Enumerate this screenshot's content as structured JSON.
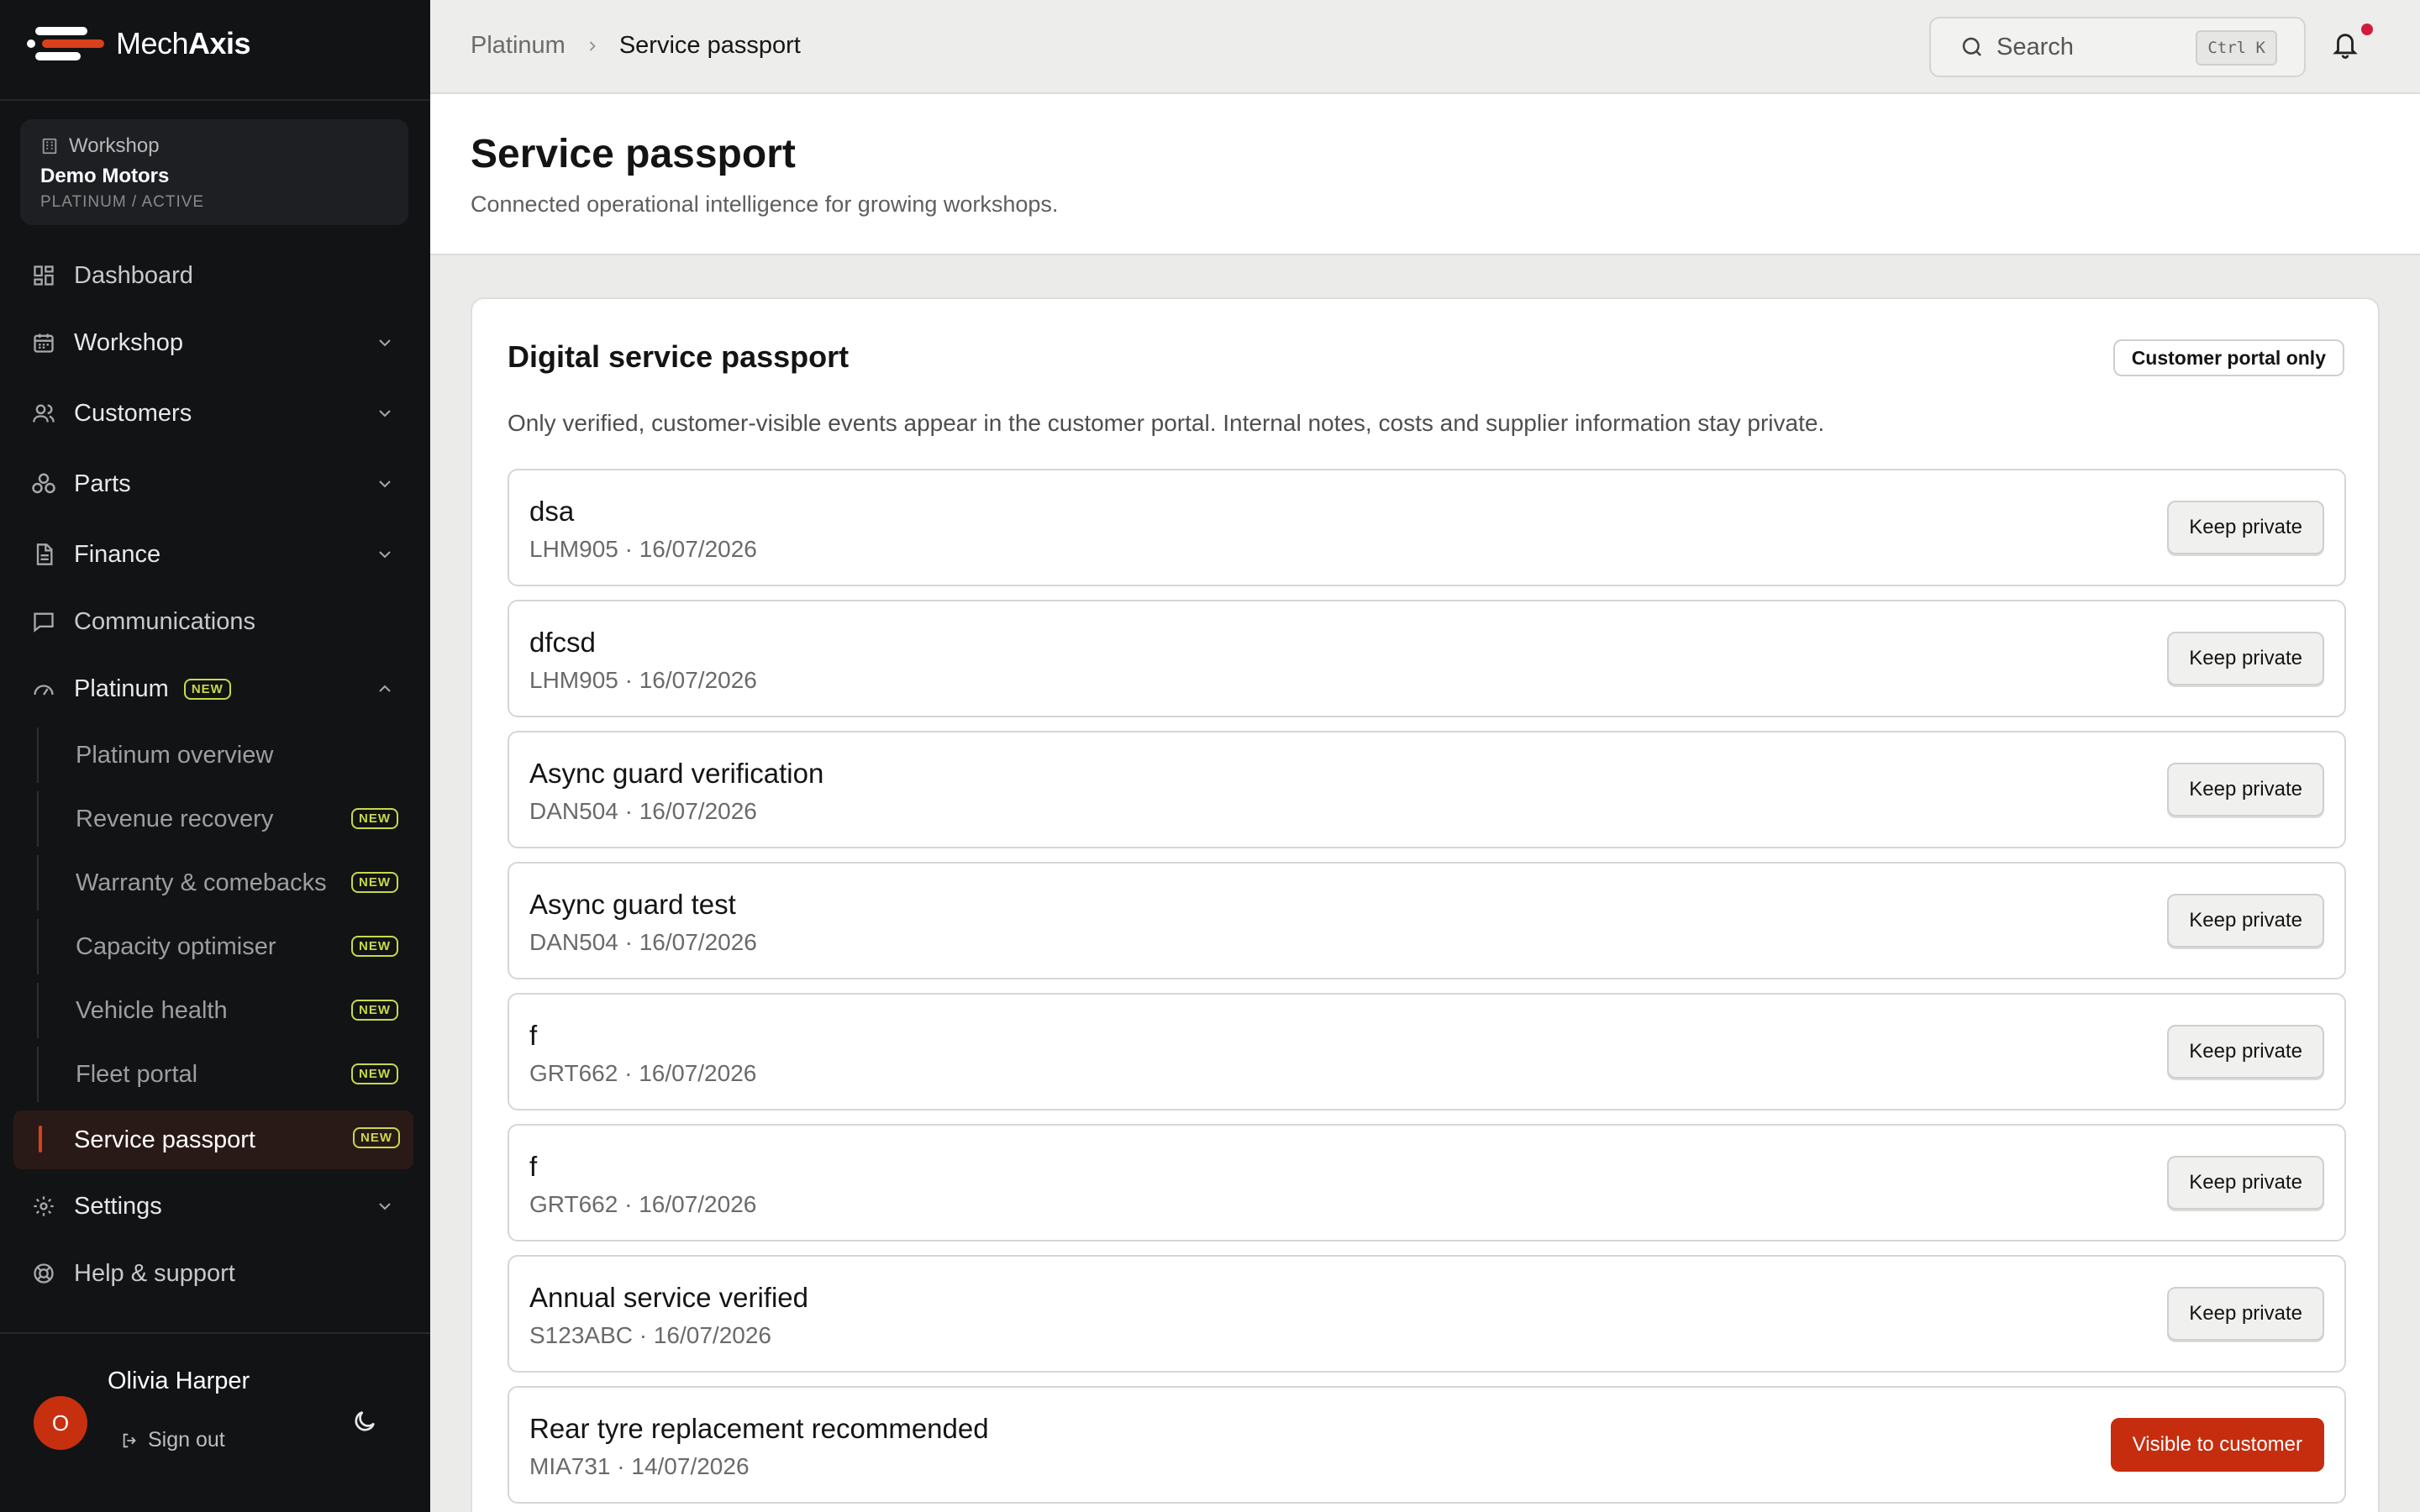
{
  "app": {
    "brand_name_a": "Mech",
    "brand_name_b": "Axis",
    "accent_color": "#c62d0e"
  },
  "workspace": {
    "label": "Workshop",
    "name": "Demo Motors",
    "status": "PLATINUM / ACTIVE"
  },
  "nav": {
    "dashboard": "Dashboard",
    "workshop": "Workshop",
    "customers": "Customers",
    "parts": "Parts",
    "finance": "Finance",
    "communications": "Communications",
    "platinum": "Platinum",
    "new_badge": "NEW",
    "settings": "Settings",
    "help": "Help & support",
    "sub": {
      "platinum_overview": "Platinum overview",
      "revenue_recovery": "Revenue recovery",
      "warranty": "Warranty & comebacks",
      "capacity": "Capacity optimiser",
      "vehicle_health": "Vehicle health",
      "fleet_portal": "Fleet portal",
      "service_passport": "Service passport"
    }
  },
  "user": {
    "initial": "O",
    "name": "Olivia Harper",
    "signout": "Sign out"
  },
  "header": {
    "crumb_parent": "Platinum",
    "crumb_current": "Service passport",
    "search_placeholder": "Search",
    "search_shortcut": "Ctrl K"
  },
  "page": {
    "title": "Service passport",
    "subtitle": "Connected operational intelligence for growing workshops."
  },
  "card": {
    "title": "Digital service passport",
    "pill": "Customer portal only",
    "description": "Only verified, customer-visible events appear in the customer portal. Internal notes, costs and supplier information stay private."
  },
  "events": [
    {
      "title": "dsa",
      "meta": "LHM905 · 16/07/2026",
      "action": "Keep private"
    },
    {
      "title": "dfcsd",
      "meta": "LHM905 · 16/07/2026",
      "action": "Keep private"
    },
    {
      "title": "Async guard verification",
      "meta": "DAN504 · 16/07/2026",
      "action": "Keep private"
    },
    {
      "title": "Async guard test",
      "meta": "DAN504 · 16/07/2026",
      "action": "Keep private"
    },
    {
      "title": "f",
      "meta": "GRT662 · 16/07/2026",
      "action": "Keep private"
    },
    {
      "title": "f",
      "meta": "GRT662 · 16/07/2026",
      "action": "Keep private"
    },
    {
      "title": "Annual service verified",
      "meta": "S123ABC · 16/07/2026",
      "action": "Keep private"
    },
    {
      "title": "Rear tyre replacement recommended",
      "meta": "MIA731 · 14/07/2026",
      "action": "Visible to customer"
    }
  ]
}
